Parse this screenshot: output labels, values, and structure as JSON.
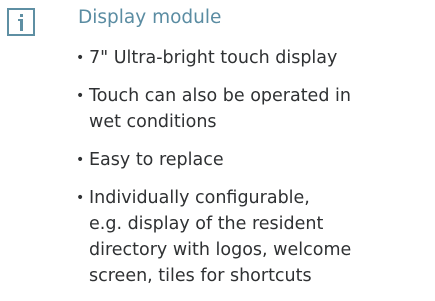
{
  "icon": "info-icon",
  "colors": {
    "accent": "#5e8fa3",
    "text": "#2f3133"
  },
  "heading": "Display module",
  "features": [
    "7\" Ultra-bright touch display",
    "Touch can also be operated in\nwet conditions",
    "Easy to replace",
    "Individually configurable,\ne.g. display of the resident\ndirectory with logos, welcome\nscreen, tiles for shortcuts"
  ]
}
